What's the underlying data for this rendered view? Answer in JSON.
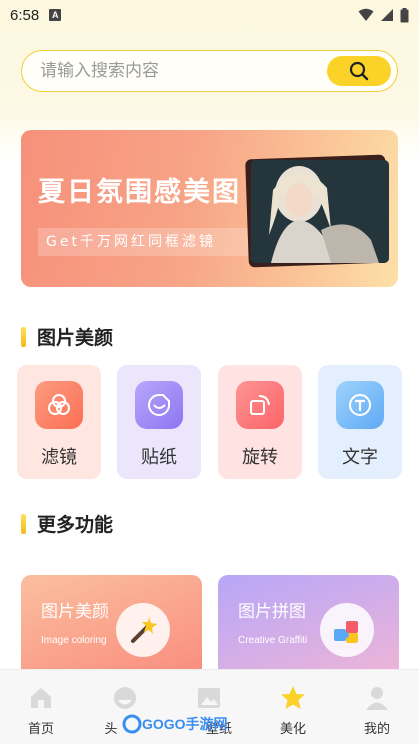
{
  "status_bar": {
    "time": "6:58",
    "notification_icon": "A"
  },
  "search": {
    "placeholder": "请输入搜索内容",
    "icon": "search-icon"
  },
  "banner": {
    "title": "夏日氛围感美图",
    "subtitle": "Get千万网红同框滤镜"
  },
  "sections": {
    "beauty_title": "图片美颜",
    "more_title": "更多功能"
  },
  "tools": [
    {
      "label": "滤镜",
      "icon": "filter-icon",
      "color": "#fb7a5c"
    },
    {
      "label": "贴纸",
      "icon": "sticker-icon",
      "color": "#9b86f5"
    },
    {
      "label": "旋转",
      "icon": "rotate-icon",
      "color": "#fb7274"
    },
    {
      "label": "文字",
      "icon": "text-icon",
      "color": "#6fb8f8"
    }
  ],
  "features": [
    {
      "title": "图片美颜",
      "subtitle": "Image coloring",
      "icon": "magic-wand-icon"
    },
    {
      "title": "图片拼图",
      "subtitle": "Creative Graffiti",
      "icon": "puzzle-icon"
    }
  ],
  "nav": [
    {
      "label": "首页",
      "icon": "home-icon",
      "active": false
    },
    {
      "label": "头",
      "icon": "avatar-icon",
      "active": false
    },
    {
      "label": "壁纸",
      "icon": "wallpaper-icon",
      "active": false
    },
    {
      "label": "美化",
      "icon": "star-icon",
      "active": true
    },
    {
      "label": "我的",
      "icon": "profile-icon",
      "active": false
    }
  ],
  "watermark": {
    "text": "GOGO手游网"
  },
  "colors": {
    "accent": "#fbd328",
    "active_nav": "#fbd328"
  }
}
